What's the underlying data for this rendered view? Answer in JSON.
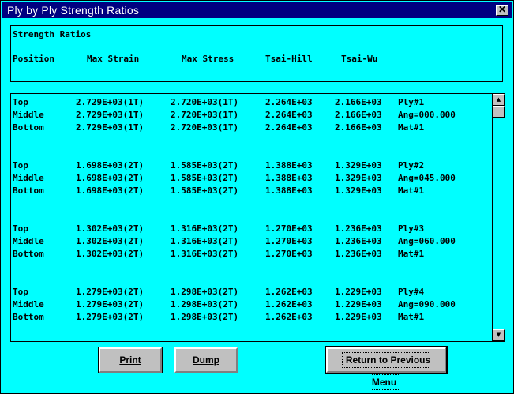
{
  "window": {
    "title": "Ply by Ply Strength Ratios",
    "close_glyph": "✕"
  },
  "header": {
    "title": "Strength Ratios",
    "columns": [
      "Position",
      "Max Strain",
      "Max Stress",
      "Tsai-Hill",
      "Tsai-Wu"
    ]
  },
  "rows": [
    {
      "pos": "Top",
      "strain": "2.729E+03(1T)",
      "stress": "2.720E+03(1T)",
      "hill": "2.264E+03",
      "wu": "2.166E+03",
      "info": "Ply#1"
    },
    {
      "pos": "Middle",
      "strain": "2.729E+03(1T)",
      "stress": "2.720E+03(1T)",
      "hill": "2.264E+03",
      "wu": "2.166E+03",
      "info": "Ang=000.000"
    },
    {
      "pos": "Bottom",
      "strain": "2.729E+03(1T)",
      "stress": "2.720E+03(1T)",
      "hill": "2.264E+03",
      "wu": "2.166E+03",
      "info": "Mat#1"
    },
    {
      "pos": "Top",
      "strain": "1.698E+03(2T)",
      "stress": "1.585E+03(2T)",
      "hill": "1.388E+03",
      "wu": "1.329E+03",
      "info": "Ply#2"
    },
    {
      "pos": "Middle",
      "strain": "1.698E+03(2T)",
      "stress": "1.585E+03(2T)",
      "hill": "1.388E+03",
      "wu": "1.329E+03",
      "info": "Ang=045.000"
    },
    {
      "pos": "Bottom",
      "strain": "1.698E+03(2T)",
      "stress": "1.585E+03(2T)",
      "hill": "1.388E+03",
      "wu": "1.329E+03",
      "info": "Mat#1"
    },
    {
      "pos": "Top",
      "strain": "1.302E+03(2T)",
      "stress": "1.316E+03(2T)",
      "hill": "1.270E+03",
      "wu": "1.236E+03",
      "info": "Ply#3"
    },
    {
      "pos": "Middle",
      "strain": "1.302E+03(2T)",
      "stress": "1.316E+03(2T)",
      "hill": "1.270E+03",
      "wu": "1.236E+03",
      "info": "Ang=060.000"
    },
    {
      "pos": "Bottom",
      "strain": "1.302E+03(2T)",
      "stress": "1.316E+03(2T)",
      "hill": "1.270E+03",
      "wu": "1.236E+03",
      "info": "Mat#1"
    },
    {
      "pos": "Top",
      "strain": "1.279E+03(2T)",
      "stress": "1.298E+03(2T)",
      "hill": "1.262E+03",
      "wu": "1.229E+03",
      "info": "Ply#4"
    },
    {
      "pos": "Middle",
      "strain": "1.279E+03(2T)",
      "stress": "1.298E+03(2T)",
      "hill": "1.262E+03",
      "wu": "1.229E+03",
      "info": "Ang=090.000"
    },
    {
      "pos": "Bottom",
      "strain": "1.279E+03(2T)",
      "stress": "1.298E+03(2T)",
      "hill": "1.262E+03",
      "wu": "1.229E+03",
      "info": "Mat#1"
    }
  ],
  "scrollbar": {
    "up_glyph": "▲",
    "down_glyph": "▼"
  },
  "buttons": {
    "print": "Print",
    "dump": "Dump",
    "return": "Return to Previous Menu"
  },
  "colors": {
    "background": "#00ffff",
    "titlebar": "#000080",
    "button": "#c0c0c0"
  }
}
